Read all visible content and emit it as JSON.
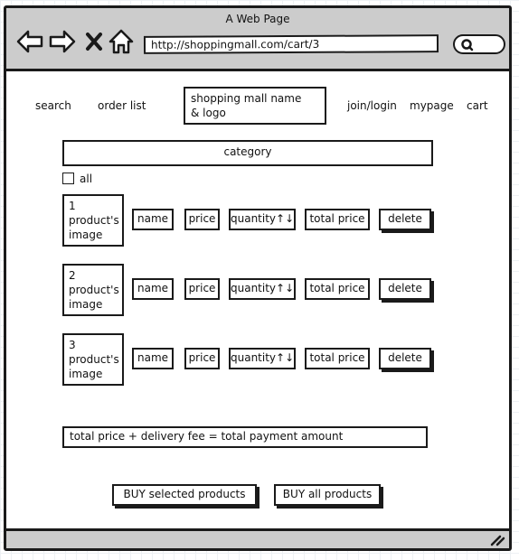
{
  "window": {
    "title": "A Web Page"
  },
  "browser": {
    "url": "http://shoppingmall.com/cart/3",
    "icons": [
      "back-arrow-icon",
      "forward-arrow-icon",
      "close-x-icon",
      "home-icon",
      "search-icon",
      "resize-grip-icon"
    ]
  },
  "nav": {
    "search": "search",
    "order_list": "order list",
    "logo_line1": "shopping mall name",
    "logo_line2": "& logo",
    "join_login": "join/login",
    "mypage": "mypage",
    "cart": "cart"
  },
  "category": "category",
  "select_all_label": "all",
  "columns": {
    "name": "name",
    "price": "price",
    "quantity": "quantity↑↓",
    "total_price": "total price",
    "delete": "delete"
  },
  "products": [
    {
      "index": "1",
      "image_line1": "product's",
      "image_line2": "image"
    },
    {
      "index": "2",
      "image_line1": "product's",
      "image_line2": "image"
    },
    {
      "index": "3",
      "image_line1": "product's",
      "image_line2": "image"
    }
  ],
  "total_summary": "total price + delivery fee = total payment amount",
  "buttons": {
    "buy_selected": "BUY selected products",
    "buy_all": "BUY all products"
  }
}
